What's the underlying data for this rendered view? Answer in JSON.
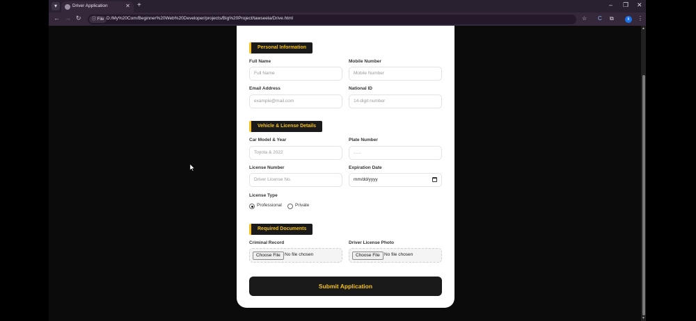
{
  "browser": {
    "tab_title": "Driver Application",
    "file_chip": "File",
    "url": "D:/My%20Com/Beginner%20Web%20Developer/projects/Big%20Project/tawseela/Drive.html",
    "profile_initial": "k"
  },
  "form": {
    "personal": {
      "title": "Personal Information",
      "full_name_label": "Full Name",
      "full_name_placeholder": "Full Name",
      "mobile_label": "Mobile Number",
      "mobile_placeholder": "Mobile Number",
      "email_label": "Email Address",
      "email_placeholder": "example@mail.com",
      "national_id_label": "National ID",
      "national_id_placeholder": "14-digit number"
    },
    "vehicle": {
      "title": "Vehicle & License Details",
      "car_model_label": "Car Model & Year",
      "car_model_placeholder": "Toyota & 2022",
      "plate_label": "Plate Number",
      "plate_placeholder": "......",
      "license_number_label": "License Number",
      "license_number_placeholder": "Driver License No.",
      "expiration_label": "Expiration Date",
      "expiration_value": "mm/dd/yyyy",
      "license_type_label": "License Type",
      "option_professional": "Professional",
      "option_private": "Private",
      "selected": "Professional"
    },
    "documents": {
      "title": "Required Documents",
      "criminal_label": "Criminal Record",
      "photo_label": "Driver License Photo",
      "choose_file": "Choose File",
      "no_file": "No file chosen"
    },
    "submit_label": "Submit Application"
  },
  "colors": {
    "accent": "#f6c21a",
    "dark": "#1a1a1a"
  }
}
